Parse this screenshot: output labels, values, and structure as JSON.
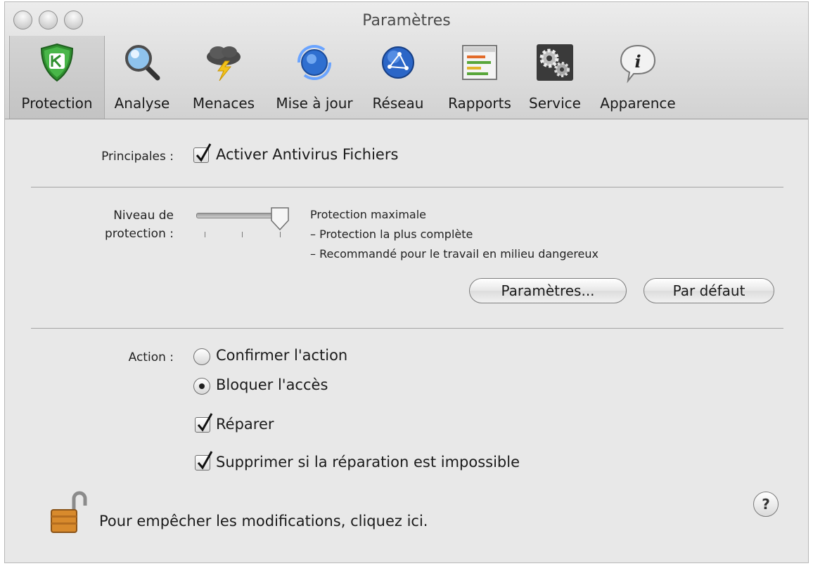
{
  "window": {
    "title": "Paramètres"
  },
  "toolbar": {
    "tabs": [
      {
        "label": "Protection",
        "icon": "kaspersky-shield-icon",
        "selected": true
      },
      {
        "label": "Analyse",
        "icon": "magnifier-icon"
      },
      {
        "label": "Menaces",
        "icon": "thunder-cloud-icon"
      },
      {
        "label": "Mise à jour",
        "icon": "update-globe-icon"
      },
      {
        "label": "Réseau",
        "icon": "network-globe-icon"
      },
      {
        "label": "Rapports",
        "icon": "report-table-icon"
      },
      {
        "label": "Service",
        "icon": "gears-icon"
      },
      {
        "label": "Apparence",
        "icon": "info-bubble-icon"
      }
    ]
  },
  "main": {
    "principales_label": "Principales :",
    "enable_antivirus": {
      "label": "Activer Antivirus Fichiers",
      "checked": true
    },
    "protection_level": {
      "label_line1": "Niveau de",
      "label_line2": "protection :",
      "slider_level": "3/3",
      "description": [
        "Protection maximale",
        "– Protection la plus complète",
        "– Recommandé pour le travail en milieu dangereux"
      ]
    },
    "settings_button": "Paramètres...",
    "default_button": "Par défaut",
    "action": {
      "label": "Action :",
      "options": [
        {
          "label": "Confirmer l'action",
          "selected": false
        },
        {
          "label": "Bloquer l'accès",
          "selected": true
        }
      ],
      "repair": {
        "label": "Réparer",
        "checked": true
      },
      "delete_if_impossible": {
        "label": "Supprimer si la réparation est impossible",
        "checked": true
      }
    },
    "lock_text": "Pour empêcher les modifications, cliquez ici.",
    "help": "?"
  }
}
